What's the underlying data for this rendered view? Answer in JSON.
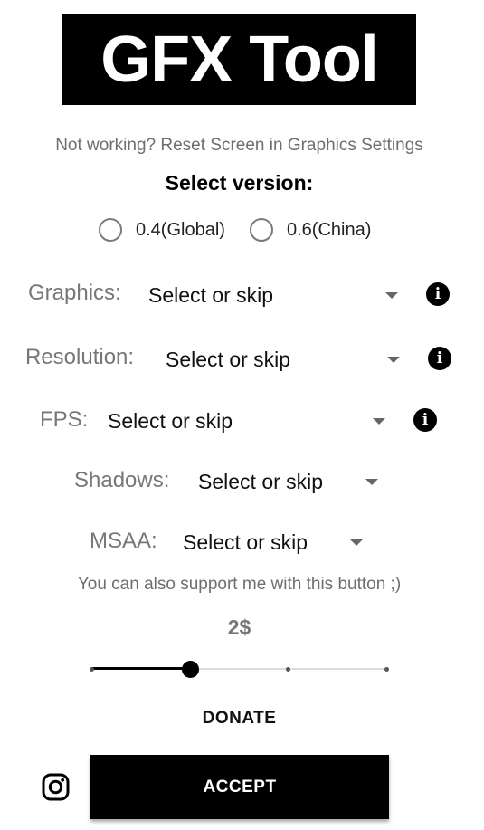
{
  "app": {
    "title": "GFX Tool",
    "hint": "Not working? Reset Screen in Graphics Settings"
  },
  "version": {
    "heading": "Select version:",
    "options": [
      {
        "label": "0.4(Global)",
        "selected": false
      },
      {
        "label": "0.6(China)",
        "selected": false
      }
    ]
  },
  "settings": {
    "graphics": {
      "label": "Graphics:",
      "value": "Select or skip",
      "has_info": true
    },
    "resolution": {
      "label": "Resolution:",
      "value": "Select or skip",
      "has_info": true
    },
    "fps": {
      "label": "FPS:",
      "value": "Select or skip",
      "has_info": true
    },
    "shadows": {
      "label": "Shadows:",
      "value": "Select or skip",
      "has_info": false
    },
    "msaa": {
      "label": "MSAA:",
      "value": "Select or skip",
      "has_info": false
    }
  },
  "donation": {
    "support_text": "You can also support me with this button ;)",
    "amount": "2$",
    "slider_level": 0.333,
    "slider_steps": 4,
    "donate_label": "DONATE"
  },
  "actions": {
    "accept_label": "ACCEPT"
  },
  "icons": {
    "info": "info-icon",
    "dropdown": "caret-down-icon",
    "instagram": "instagram-icon"
  },
  "colors": {
    "primary": "#000000",
    "background": "#ffffff",
    "muted_text": "#6e6e6e"
  }
}
